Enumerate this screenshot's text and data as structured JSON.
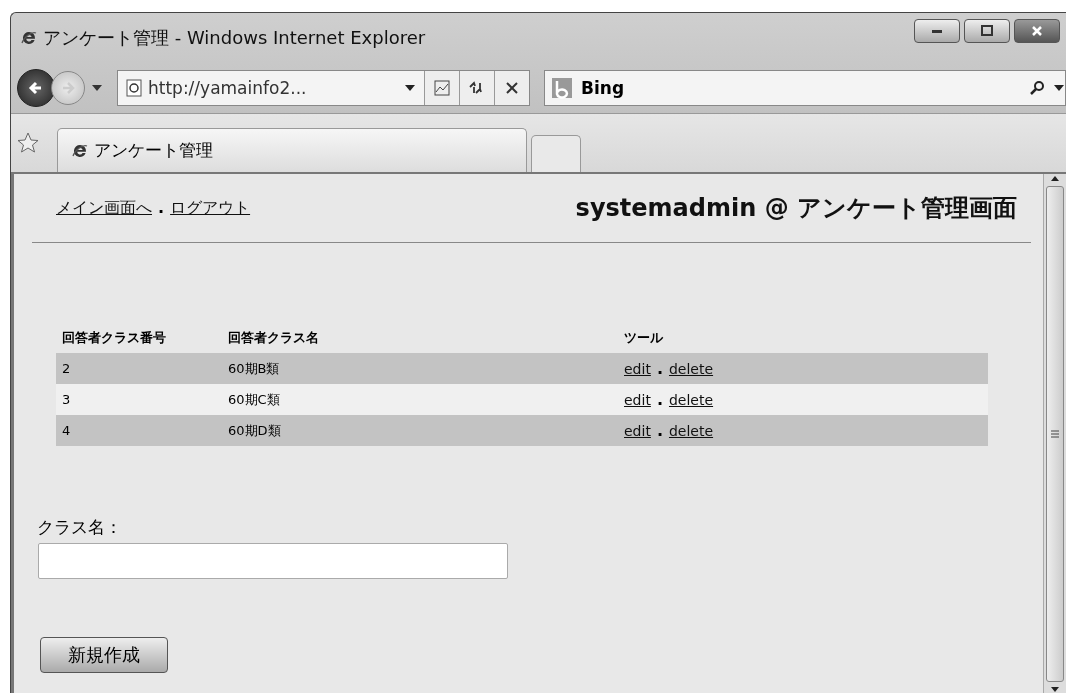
{
  "window": {
    "title": "アンケート管理 - Windows Internet Explorer"
  },
  "address_bar": {
    "value": "http://yamainfo2..."
  },
  "search_bar": {
    "value": "Bing"
  },
  "tabs": [
    {
      "label": "アンケート管理",
      "selected": true
    }
  ],
  "page": {
    "links": [
      "メイン画面へ",
      "ログアウト"
    ],
    "link_separator": ".",
    "heading": "systemadmin @ アンケート管理画面",
    "table": {
      "columns": [
        "回答者クラス番号",
        "回答者クラス名",
        "ツール"
      ],
      "rows": [
        {
          "number": "2",
          "name": "60期B類",
          "actions": [
            "edit",
            "delete"
          ]
        },
        {
          "number": "3",
          "name": "60期C類",
          "actions": [
            "edit",
            "delete"
          ]
        },
        {
          "number": "4",
          "name": "60期D類",
          "actions": [
            "edit",
            "delete"
          ]
        }
      ],
      "action_separator": "."
    },
    "form": {
      "label": "クラス名：",
      "button": "新規作成"
    }
  }
}
